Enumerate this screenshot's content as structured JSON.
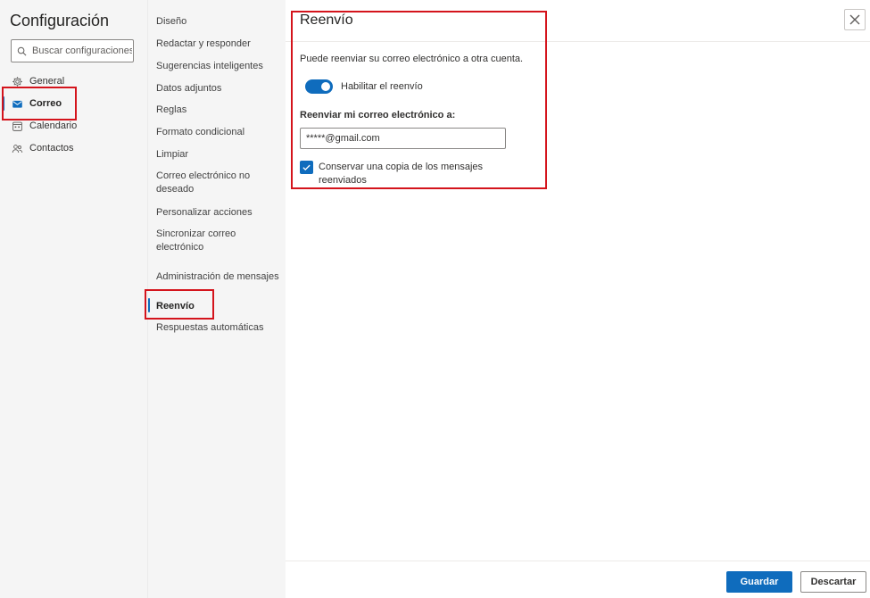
{
  "app": {
    "title": "Configuración"
  },
  "search": {
    "placeholder": "Buscar configuraciones"
  },
  "categories": [
    {
      "label": "General",
      "icon": "gear-icon"
    },
    {
      "label": "Correo",
      "icon": "mail-icon",
      "active": true
    },
    {
      "label": "Calendario",
      "icon": "calendar-icon"
    },
    {
      "label": "Contactos",
      "icon": "people-icon"
    }
  ],
  "subnav": [
    {
      "label": "Diseño"
    },
    {
      "label": "Redactar y responder"
    },
    {
      "label": "Sugerencias inteligentes"
    },
    {
      "label": "Datos adjuntos"
    },
    {
      "label": "Reglas"
    },
    {
      "label": "Formato condicional"
    },
    {
      "label": "Limpiar"
    },
    {
      "label": "Correo electrónico no deseado"
    },
    {
      "label": "Personalizar acciones"
    },
    {
      "label": "Sincronizar correo electrónico"
    },
    {
      "label": "Administración de mensajes"
    },
    {
      "label": "Reenvío",
      "active": true
    },
    {
      "label": "Respuestas automáticas"
    }
  ],
  "pane": {
    "title": "Reenvío",
    "description": "Puede reenviar su correo electrónico a otra cuenta.",
    "enable_toggle": {
      "label": "Habilitar el reenvío",
      "on": true
    },
    "forward_to": {
      "label": "Reenviar mi correo electrónico a:",
      "value": "*****@gmail.com"
    },
    "keep_copy": {
      "label": "Conservar una copia de los mensajes reenviados",
      "checked": true
    }
  },
  "footer": {
    "save_label": "Guardar",
    "discard_label": "Descartar"
  },
  "colors": {
    "accent": "#0f6cbd",
    "highlight": "#d4141c",
    "nav_bg": "#f5f5f5"
  }
}
